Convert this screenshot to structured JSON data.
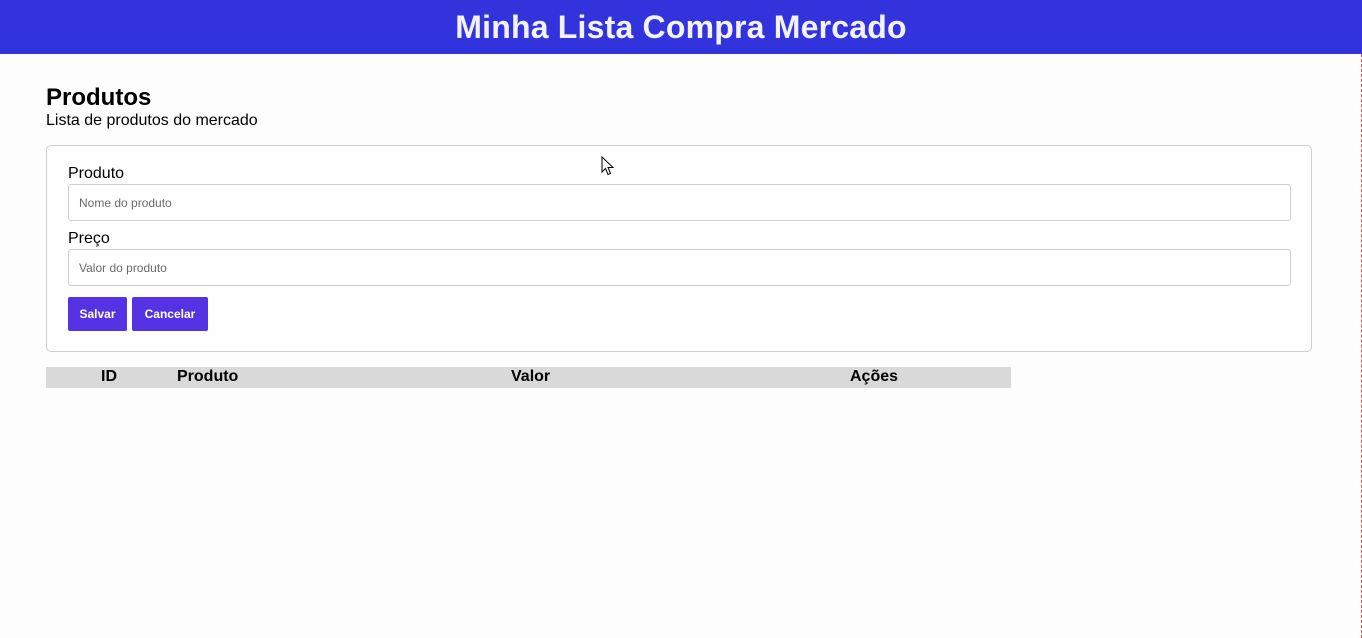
{
  "header": {
    "title": "Minha Lista Compra Mercado"
  },
  "page": {
    "title": "Produtos",
    "subtitle": "Lista de produtos do mercado"
  },
  "form": {
    "product_label": "Produto",
    "product_placeholder": "Nome do produto",
    "product_value": "",
    "price_label": "Preço",
    "price_placeholder": "Valor do produto",
    "price_value": "",
    "save_label": "Salvar",
    "cancel_label": "Cancelar"
  },
  "table": {
    "columns": [
      "ID",
      "Produto",
      "Valor",
      "Ações"
    ],
    "rows": []
  },
  "colors": {
    "header_bg": "#3333dd",
    "button_bg": "#5533e5",
    "table_head_bg": "#d9d9d9"
  }
}
